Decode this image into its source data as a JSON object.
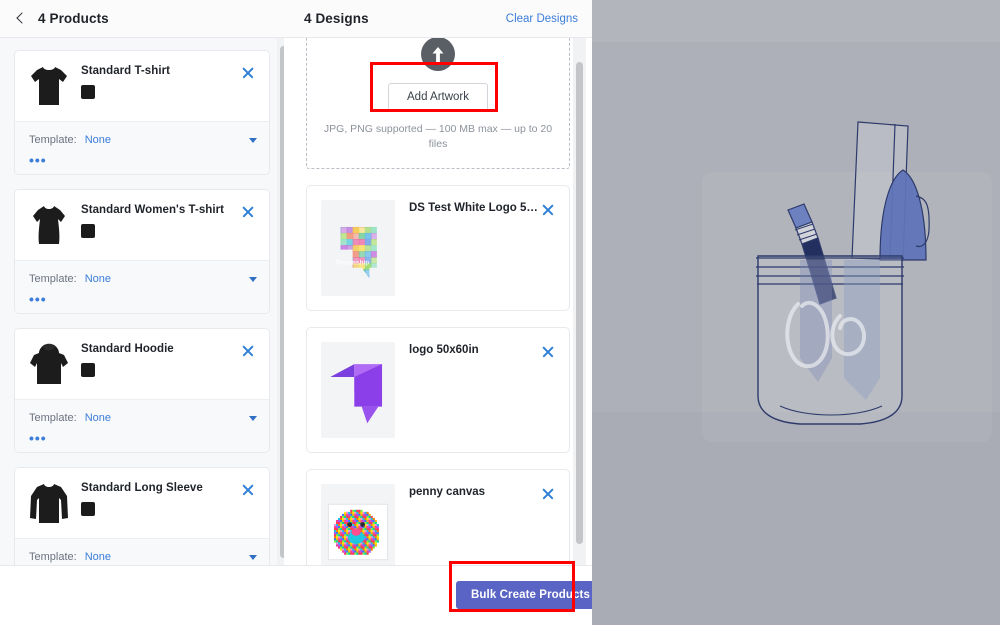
{
  "products_header": {
    "back_icon": "chevron-left-icon",
    "title": "4 Products"
  },
  "designs_header": {
    "title": "4 Designs",
    "clear_link": "Clear Designs"
  },
  "products": [
    {
      "name": "Standard T-shirt",
      "garment": "tshirt",
      "swatch": "#1b1b1b",
      "template_label": "Template:",
      "template_value": "None",
      "more_label": "•••",
      "remove_icon": "close-icon"
    },
    {
      "name": "Standard Women's T-shirt",
      "garment": "womens-tshirt",
      "swatch": "#1b1b1b",
      "template_label": "Template:",
      "template_value": "None",
      "more_label": "•••",
      "remove_icon": "close-icon"
    },
    {
      "name": "Standard Hoodie",
      "garment": "hoodie",
      "swatch": "#1b1b1b",
      "template_label": "Template:",
      "template_value": "None",
      "more_label": "•••",
      "remove_icon": "close-icon"
    },
    {
      "name": "Standard Long Sleeve",
      "garment": "long-sleeve",
      "swatch": "#1b1b1b",
      "template_label": "Template:",
      "template_value": "None",
      "more_label": "•••",
      "remove_icon": "close-icon"
    }
  ],
  "dropzone": {
    "upload_icon": "upload-arrow-icon",
    "button_label": "Add Artwork",
    "hint": "JPG, PNG supported — 100 MB max — up to 20 files"
  },
  "designs": [
    {
      "name": "DS Test White Logo 50x...",
      "thumb": "dreamship-floral-logo",
      "remove_icon": "close-icon"
    },
    {
      "name": "logo 50x60in",
      "thumb": "purple-geometric-logo",
      "remove_icon": "close-icon"
    },
    {
      "name": "penny canvas",
      "thumb": "colorful-dog-portrait",
      "remove_icon": "close-icon"
    }
  ],
  "footer": {
    "bulk_button": "Bulk Create Products"
  },
  "preview": {
    "illustration": "jar-with-pens-and-pencil-illustration"
  },
  "colors": {
    "link": "#3b7dd8",
    "primary_button": "#5a64c4",
    "annotation": "#fe0000",
    "swatch_black": "#1b1b1b",
    "panel_bg": "#f7f8fa",
    "preview_bg": "#adb0b8"
  },
  "annotations": [
    {
      "target": "add-artwork-button"
    },
    {
      "target": "bulk-create-products-button"
    }
  ]
}
